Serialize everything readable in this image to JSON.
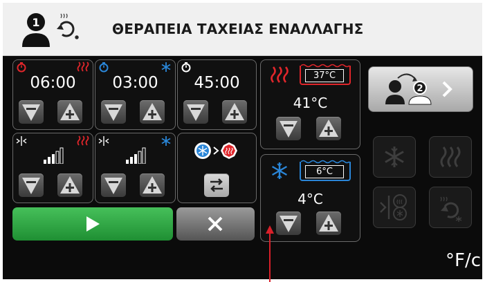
{
  "header": {
    "step_number": "1",
    "title": "ΘΕΡΑΠΕΙΑ ΤΑΧΕΙΑΣ ΕΝΑΛΛΑΓΗΣ"
  },
  "timers": {
    "heat_time": "06:00",
    "cold_time": "03:00",
    "total_time": "45:00"
  },
  "temps": {
    "hot_tank": "37°C",
    "hot_target": "41°C",
    "cold_tank": "6°C",
    "cold_target": "4°C"
  },
  "intensity": {
    "heat_bars": 3,
    "cold_bars": 3
  },
  "next_step_number": "2",
  "unit_toggle": "°F/c",
  "colors": {
    "heat": "#e0262b",
    "cold": "#2a86d8",
    "start": "#2fa843"
  }
}
